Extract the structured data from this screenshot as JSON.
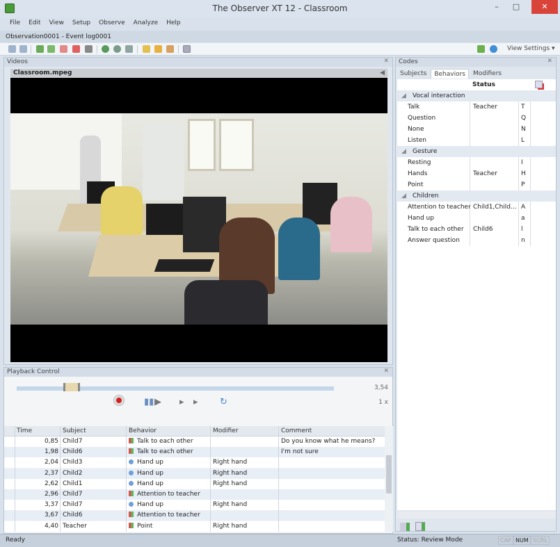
{
  "window": {
    "title": "The Observer XT 12 - Classroom",
    "minimize": "–",
    "maximize": "□",
    "close": "✕"
  },
  "menu": [
    "File",
    "Edit",
    "View",
    "Setup",
    "Observe",
    "Analyze",
    "Help"
  ],
  "observation_label": "Observation0001 - Event log0001",
  "toolbar": {
    "view_settings": "View Settings ▾"
  },
  "videos": {
    "title": "Videos",
    "close": "✕",
    "file": "Classroom.mpeg",
    "volume": "◀"
  },
  "playback": {
    "title": "Playback Control",
    "close": "✕",
    "time": "3,54",
    "speed": "1 x",
    "progress_fraction": 0.2
  },
  "events": {
    "columns": [
      "Time",
      "Subject",
      "Behavior",
      "Modifier",
      "Comment"
    ],
    "rows": [
      {
        "time": "0,85",
        "subject": "Child7",
        "behavior": "Talk to each other",
        "icon": "state",
        "modifier": "",
        "comment": "Do you know what he means?"
      },
      {
        "time": "1,98",
        "subject": "Child6",
        "behavior": "Talk to each other",
        "icon": "state",
        "modifier": "",
        "comment": "I'm not sure"
      },
      {
        "time": "2,04",
        "subject": "Child3",
        "behavior": "Hand up",
        "icon": "point",
        "modifier": "Right hand",
        "comment": ""
      },
      {
        "time": "2,37",
        "subject": "Child2",
        "behavior": "Hand up",
        "icon": "point",
        "modifier": "Right hand",
        "comment": ""
      },
      {
        "time": "2,62",
        "subject": "Child1",
        "behavior": "Hand up",
        "icon": "point",
        "modifier": "Right hand",
        "comment": ""
      },
      {
        "time": "2,96",
        "subject": "Child7",
        "behavior": "Attention to teacher",
        "icon": "state",
        "modifier": "",
        "comment": ""
      },
      {
        "time": "3,37",
        "subject": "Child7",
        "behavior": "Hand up",
        "icon": "point",
        "modifier": "Right hand",
        "comment": ""
      },
      {
        "time": "3,67",
        "subject": "Child6",
        "behavior": "Attention to teacher",
        "icon": "state",
        "modifier": "",
        "comment": ""
      },
      {
        "time": "4,40",
        "subject": "Teacher",
        "behavior": "Point",
        "icon": "state",
        "modifier": "Right hand",
        "comment": ""
      }
    ]
  },
  "codes": {
    "title": "Codes",
    "close": "✕",
    "tabs": [
      "Subjects",
      "Behaviors",
      "Modifiers"
    ],
    "status_header": "Status",
    "rows": [
      {
        "group": true,
        "label": "Vocal interaction"
      },
      {
        "label": "Talk",
        "status": "Teacher",
        "key": "T"
      },
      {
        "label": "Question",
        "status": "",
        "key": "Q"
      },
      {
        "label": "None",
        "status": "",
        "key": "N"
      },
      {
        "label": "Listen",
        "status": "",
        "key": "L"
      },
      {
        "group": true,
        "label": "Gesture"
      },
      {
        "label": "Resting",
        "status": "",
        "key": "I"
      },
      {
        "label": "Hands",
        "status": "Teacher",
        "key": "H"
      },
      {
        "label": "Point",
        "status": "",
        "key": "P"
      },
      {
        "group": true,
        "label": "Children"
      },
      {
        "label": "Attention to teacher",
        "status": "Child1,Child...",
        "key": "A"
      },
      {
        "label": "Hand up",
        "status": "",
        "key": "a"
      },
      {
        "label": "Talk to each other",
        "status": "Child6",
        "key": "l"
      },
      {
        "label": "Answer question",
        "status": "",
        "key": "n"
      }
    ]
  },
  "status": {
    "left": "Ready",
    "mode": "Status: Review Mode",
    "caps": "CAP",
    "num": "NUM",
    "scrl": "SCRL"
  },
  "colors": {
    "accent": "#c4d6ea",
    "close": "#d9443a",
    "record": "#d42020"
  }
}
